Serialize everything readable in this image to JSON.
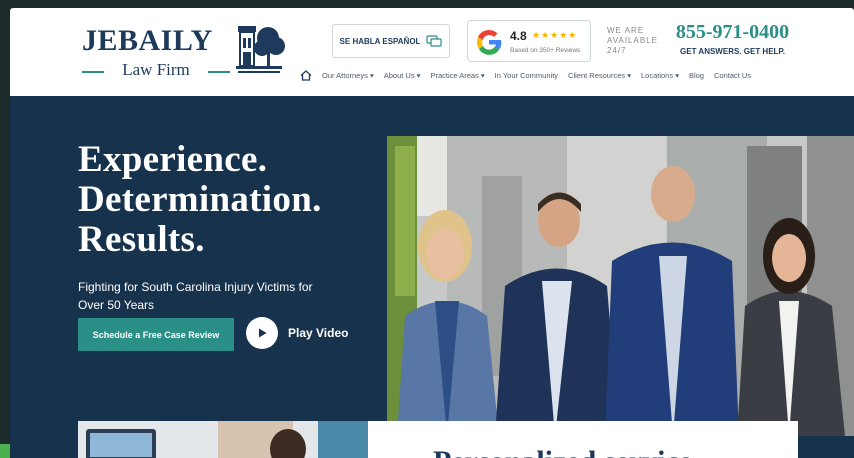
{
  "header": {
    "logo_main": "JEBAILY",
    "logo_sub": "Law Firm",
    "spanish_label": "SE HABLA ESPAÑOL",
    "google": {
      "rating": "4.8",
      "stars": "★★★★★",
      "sub": "Based on 350+ Reviews"
    },
    "availability": "WE ARE AVAILABLE 24/7",
    "phone": "855-971-0400",
    "phone_cta": "GET ANSWERS. GET HELP."
  },
  "nav": {
    "home_icon": "home-icon",
    "items": [
      {
        "label": "Our Attorneys",
        "dropdown": true
      },
      {
        "label": "About Us",
        "dropdown": true
      },
      {
        "label": "Practice Areas",
        "dropdown": true
      },
      {
        "label": "In Your Community",
        "dropdown": false
      },
      {
        "label": "Client Resources",
        "dropdown": true
      },
      {
        "label": "Locations",
        "dropdown": true
      },
      {
        "label": "Blog",
        "dropdown": false
      },
      {
        "label": "Contact Us",
        "dropdown": false
      }
    ]
  },
  "hero": {
    "headline_1": "Experience.",
    "headline_2": "Determination.",
    "headline_3": "Results.",
    "subtext": "Fighting for South Carolina Injury Victims for Over 50 Years",
    "cta_label": "Schedule a Free Case Review",
    "play_label": "Play Video"
  },
  "colors": {
    "navy": "#17324d",
    "teal": "#2a8f86",
    "white": "#ffffff"
  }
}
